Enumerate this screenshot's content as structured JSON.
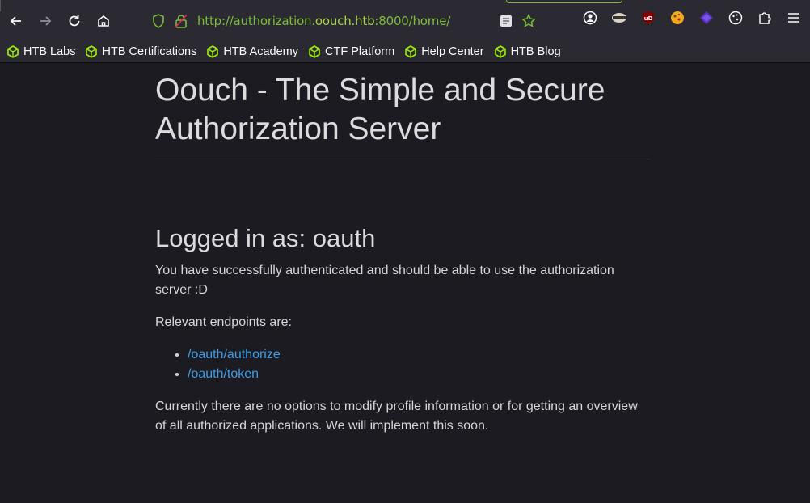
{
  "browser": {
    "url_prefix": "http://authorization.",
    "url_host": "oouch.htb",
    "url_suffix": ":8000/home/"
  },
  "bookmarks": [
    {
      "label": "HTB Labs"
    },
    {
      "label": "HTB Certifications"
    },
    {
      "label": "HTB Academy"
    },
    {
      "label": "CTF Platform"
    },
    {
      "label": "Help Center"
    },
    {
      "label": "HTB Blog"
    }
  ],
  "page": {
    "title": "Oouch - The Simple and Secure Authorization Server",
    "logged_in": "Logged in as: oauth",
    "success_text": "You have successfully authenticated and should be able to use the authorization server :D",
    "endpoints_intro": "Relevant endpoints are:",
    "endpoints": [
      "/oauth/authorize",
      "/oauth/token"
    ],
    "footer_text": "Currently there are no options to modify profile information or for getting an overview of all authorized applications. We will implement this soon."
  },
  "colors": {
    "accent": "#7cbc3b",
    "link": "#3c9ee6",
    "background": "#1c1b22"
  }
}
